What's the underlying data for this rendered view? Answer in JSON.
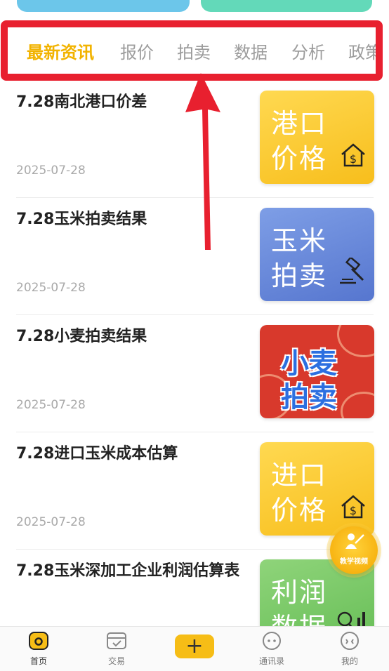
{
  "tabs": [
    "最新资讯",
    "报价",
    "拍卖",
    "数据",
    "分析",
    "政策"
  ],
  "news": [
    {
      "title": "7.28南北港口价差",
      "date": "2025-07-28",
      "thumb_line1": "港口",
      "thumb_line2": "价格"
    },
    {
      "title": "7.28玉米拍卖结果",
      "date": "2025-07-28",
      "thumb_line1": "玉米",
      "thumb_line2": "拍卖"
    },
    {
      "title": "7.28小麦拍卖结果",
      "date": "2025-07-28",
      "thumb_line1": "小麦",
      "thumb_line2": "拍卖"
    },
    {
      "title": "7.28进口玉米成本估算",
      "date": "2025-07-28",
      "thumb_line1": "进口",
      "thumb_line2": "价格"
    },
    {
      "title": "7.28玉米深加工企业利润估算表",
      "date": "",
      "thumb_line1": "利润",
      "thumb_line2": "数据"
    }
  ],
  "fab_label": "教学视频",
  "bottom_nav": {
    "home": "首页",
    "trade": "交易",
    "add": "+",
    "contacts": "通讯录",
    "mine": "我的"
  },
  "colors": {
    "accent": "#f2b300",
    "highlight_frame": "#e8202f",
    "tab_inactive": "#9c9c9c"
  },
  "icons": [
    "house-dollar-icon",
    "gavel-icon",
    "chart-magnifier-icon",
    "home-icon",
    "trade-icon",
    "plus-icon",
    "chat-icon",
    "profile-icon"
  ]
}
